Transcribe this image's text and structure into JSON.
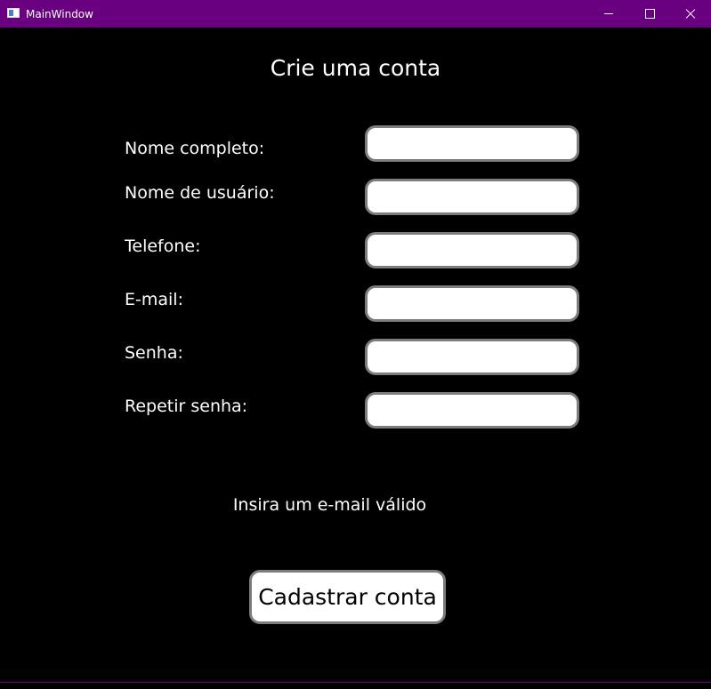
{
  "window": {
    "title": "MainWindow",
    "accent_color": "#68007f",
    "controls": {
      "minimize": "minimize-icon",
      "maximize": "maximize-icon",
      "close": "close-icon"
    }
  },
  "form": {
    "heading": "Crie uma conta",
    "fields": [
      {
        "label": "Nome completo:",
        "value": ""
      },
      {
        "label": "Nome de usuário:",
        "value": ""
      },
      {
        "label": "Telefone:",
        "value": ""
      },
      {
        "label": "E-mail:",
        "value": ""
      },
      {
        "label": "Senha:",
        "value": ""
      },
      {
        "label": "Repetir senha:",
        "value": ""
      }
    ],
    "message": "Insira um e-mail válido",
    "submit_label": "Cadastrar conta"
  }
}
